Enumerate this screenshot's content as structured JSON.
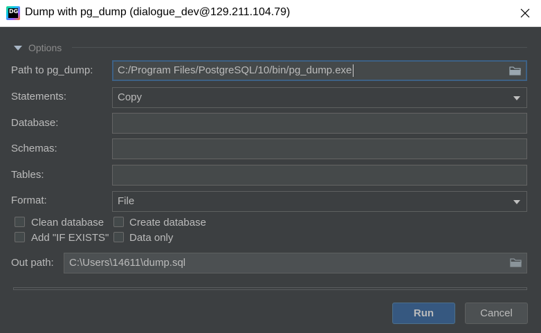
{
  "window": {
    "title": "Dump with pg_dump (dialogue_dev@129.211.104.79)",
    "icon": "datagrip-app-icon",
    "icon_text": "DG"
  },
  "options": {
    "header": "Options",
    "path_label": "Path to pg_dump:",
    "path_value": "C:/Program Files/PostgreSQL/10/bin/pg_dump.exe",
    "statements_label": "Statements:",
    "statements_value": "Copy",
    "database_label": "Database:",
    "database_value": "",
    "schemas_label": "Schemas:",
    "schemas_value": "",
    "tables_label": "Tables:",
    "tables_value": "",
    "format_label": "Format:",
    "format_value": "File",
    "clean_database_label": "Clean database",
    "create_database_label": "Create database",
    "add_if_exists_label": "Add \"IF EXISTS\"",
    "data_only_label": "Data only",
    "out_path_label": "Out path:",
    "out_path_value": "C:\\Users\\14611\\dump.sql"
  },
  "buttons": {
    "run": "Run",
    "cancel": "Cancel"
  },
  "colors": {
    "background": "#3c3f41",
    "field_background": "#45494a",
    "focus_border": "#3d6185",
    "primary_button": "#365880"
  }
}
